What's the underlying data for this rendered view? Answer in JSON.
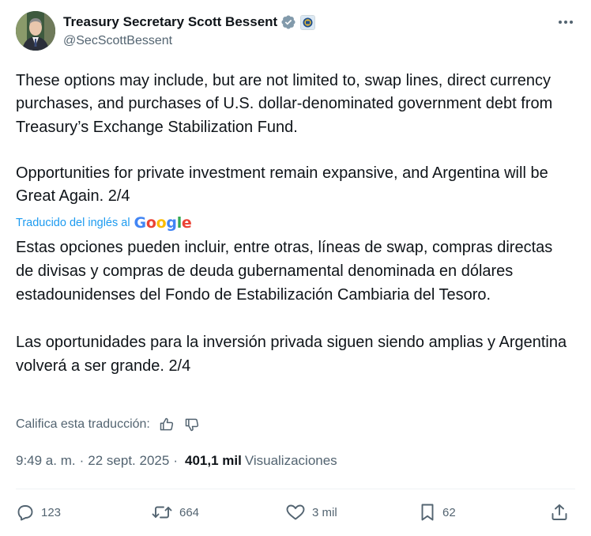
{
  "author": {
    "display_name": "Treasury Secretary Scott Bessent",
    "handle": "@SecScottBessent",
    "verified_icon": "verified-badge-icon",
    "affiliation_icon": "treasury-seal-icon",
    "colors": {
      "verified": "#829aab",
      "handle": "#536471"
    }
  },
  "menu": {
    "more_icon": "more-horizontal-icon"
  },
  "tweet": {
    "paragraph_1": "These options may include, but are not limited to, swap lines, direct currency purchases, and purchases of U.S. dollar-denominated government debt from Treasury’s Exchange Stabilization Fund.",
    "paragraph_2": "Opportunities for private investment remain expansive, and Argentina will be Great Again. 2/4"
  },
  "translation": {
    "label": "Traducido del inglés al",
    "provider_logo": "Google",
    "paragraph_1": "Estas opciones pueden incluir, entre otras, líneas de swap, compras directas de divisas y compras de deuda gubernamental denominada en dólares estadounidenses del Fondo de Estabilización Cambiaria del Tesoro.",
    "paragraph_2": "Las oportunidades para la inversión privada siguen siendo amplias y Argentina volverá a ser grande. 2/4",
    "rate_label": "Califica esta traducción:",
    "colors": {
      "link": "#1d9bf0"
    }
  },
  "meta": {
    "time": "9:49 a. m.",
    "separator": "·",
    "date": "22 sept. 2025",
    "views_count": "401,1 mil",
    "views_label": "Visualizaciones"
  },
  "actions": {
    "replies": "123",
    "reposts": "664",
    "likes": "3 mil",
    "bookmarks": "62"
  }
}
